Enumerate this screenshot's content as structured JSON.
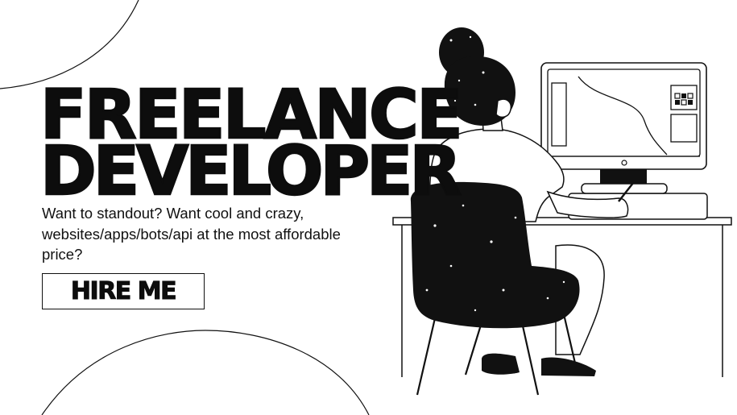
{
  "headline": {
    "line1": "FREELANCE",
    "line2": "DEVELOPER"
  },
  "tagline": "Want to standout? Want cool and crazy, websites/apps/bots/api at the most affordable price?",
  "cta": {
    "label": "HIRE ME"
  },
  "colors": {
    "ink": "#0d0d0d",
    "background": "#ffffff"
  }
}
